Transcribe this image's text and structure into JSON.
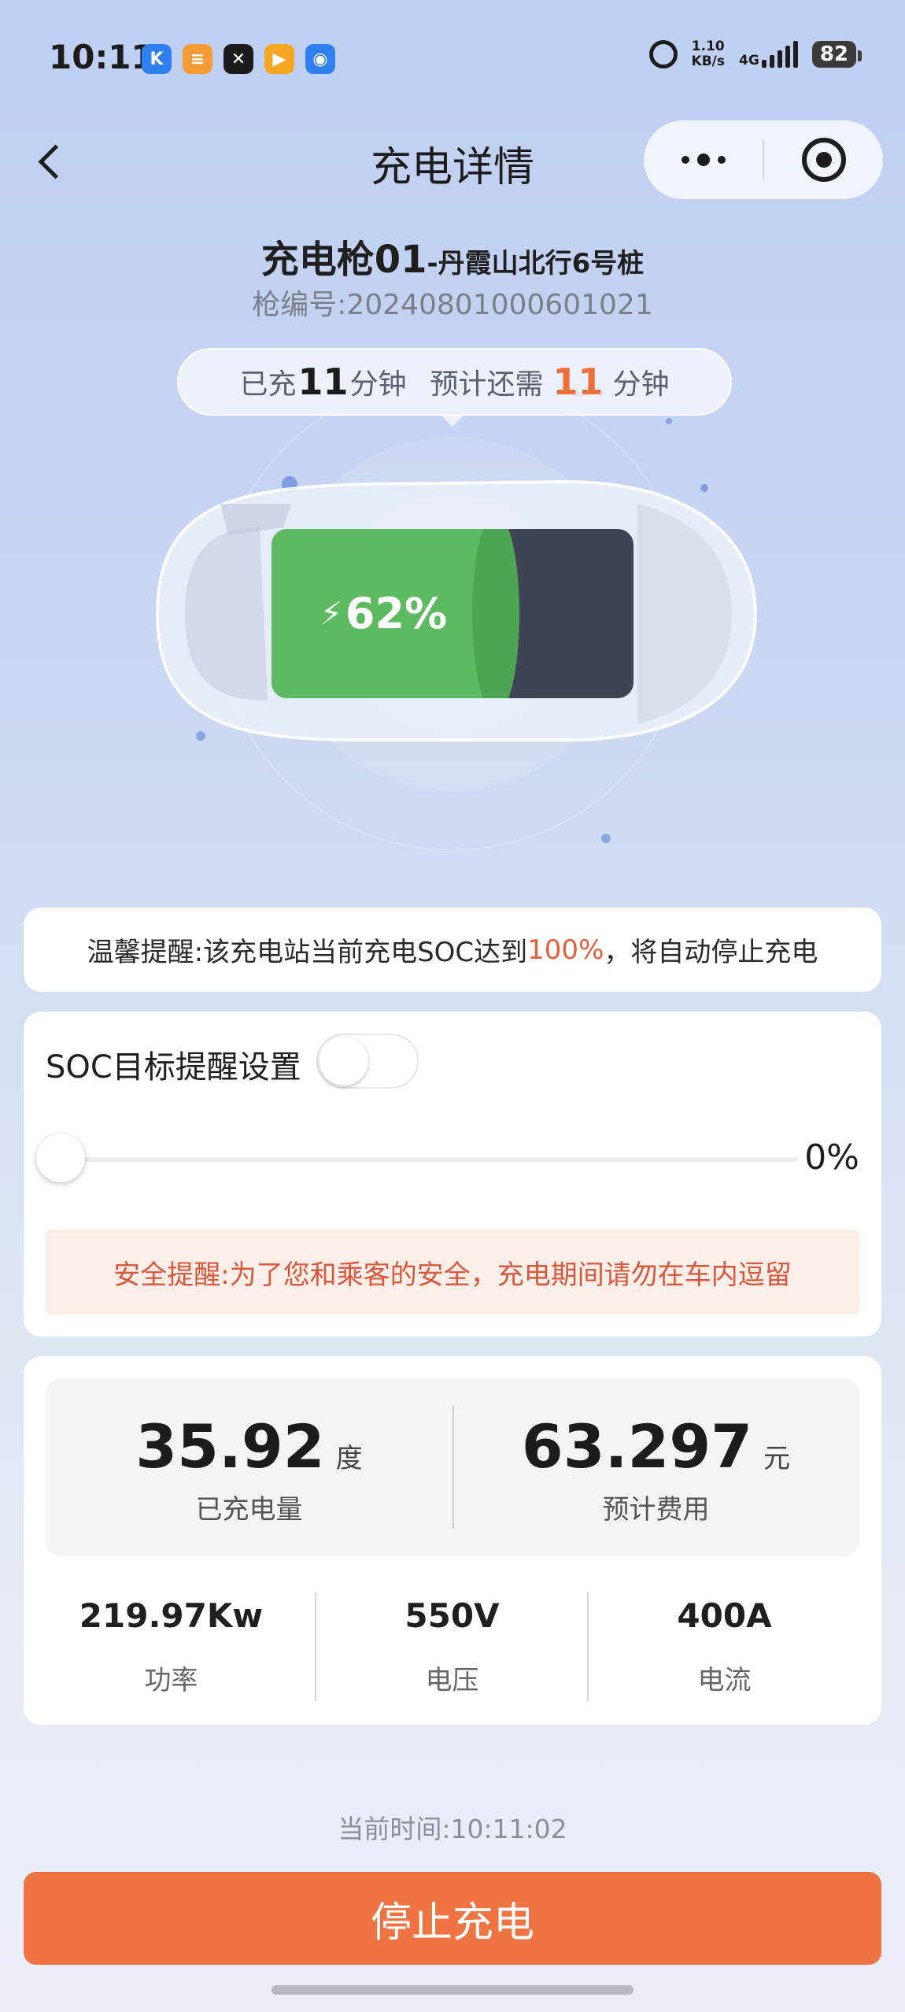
{
  "status_bar": {
    "time": "10:11",
    "net_speed_value": "1.10",
    "net_speed_unit": "KB/s",
    "network": "4G",
    "battery": "82"
  },
  "nav": {
    "title": "充电详情"
  },
  "gun": {
    "name": "充电枪01",
    "location": "-丹霞山北行6号桩",
    "number_label": "枪编号:20240801000601021"
  },
  "time_pill": {
    "charged_prefix": "已充",
    "charged_value": "11",
    "charged_unit": "分钟",
    "remaining_prefix": "预计还需",
    "remaining_value": "11",
    "remaining_unit": "分钟"
  },
  "battery_level": {
    "text": "62%",
    "fraction": 0.62
  },
  "tip": {
    "prefix": "温馨提醒:该充电站当前充电SOC达到",
    "highlight": "100%",
    "suffix": "，将自动停止充电"
  },
  "soc_setting": {
    "label": "SOC目标提醒设置",
    "toggle_on": false,
    "slider_value": "0%",
    "slider_fraction": 0
  },
  "safety_notice": "安全提醒:为了您和乘客的安全，充电期间请勿在车内逗留",
  "stats": {
    "energy": {
      "value": "35.92",
      "unit": "度",
      "label": "已充电量"
    },
    "cost": {
      "value": "63.297",
      "unit": "元",
      "label": "预计费用"
    },
    "power": {
      "value": "219.97Kw",
      "label": "功率"
    },
    "voltage": {
      "value": "550V",
      "label": "电压"
    },
    "current": {
      "value": "400A",
      "label": "电流"
    }
  },
  "current_time": "当前时间:10:11:02",
  "stop_button": "停止充电",
  "colors": {
    "accent_orange": "#ef7442",
    "battery_green": "#5cba61",
    "battery_empty": "#3f4455",
    "highlight_red": "#e2603a"
  }
}
